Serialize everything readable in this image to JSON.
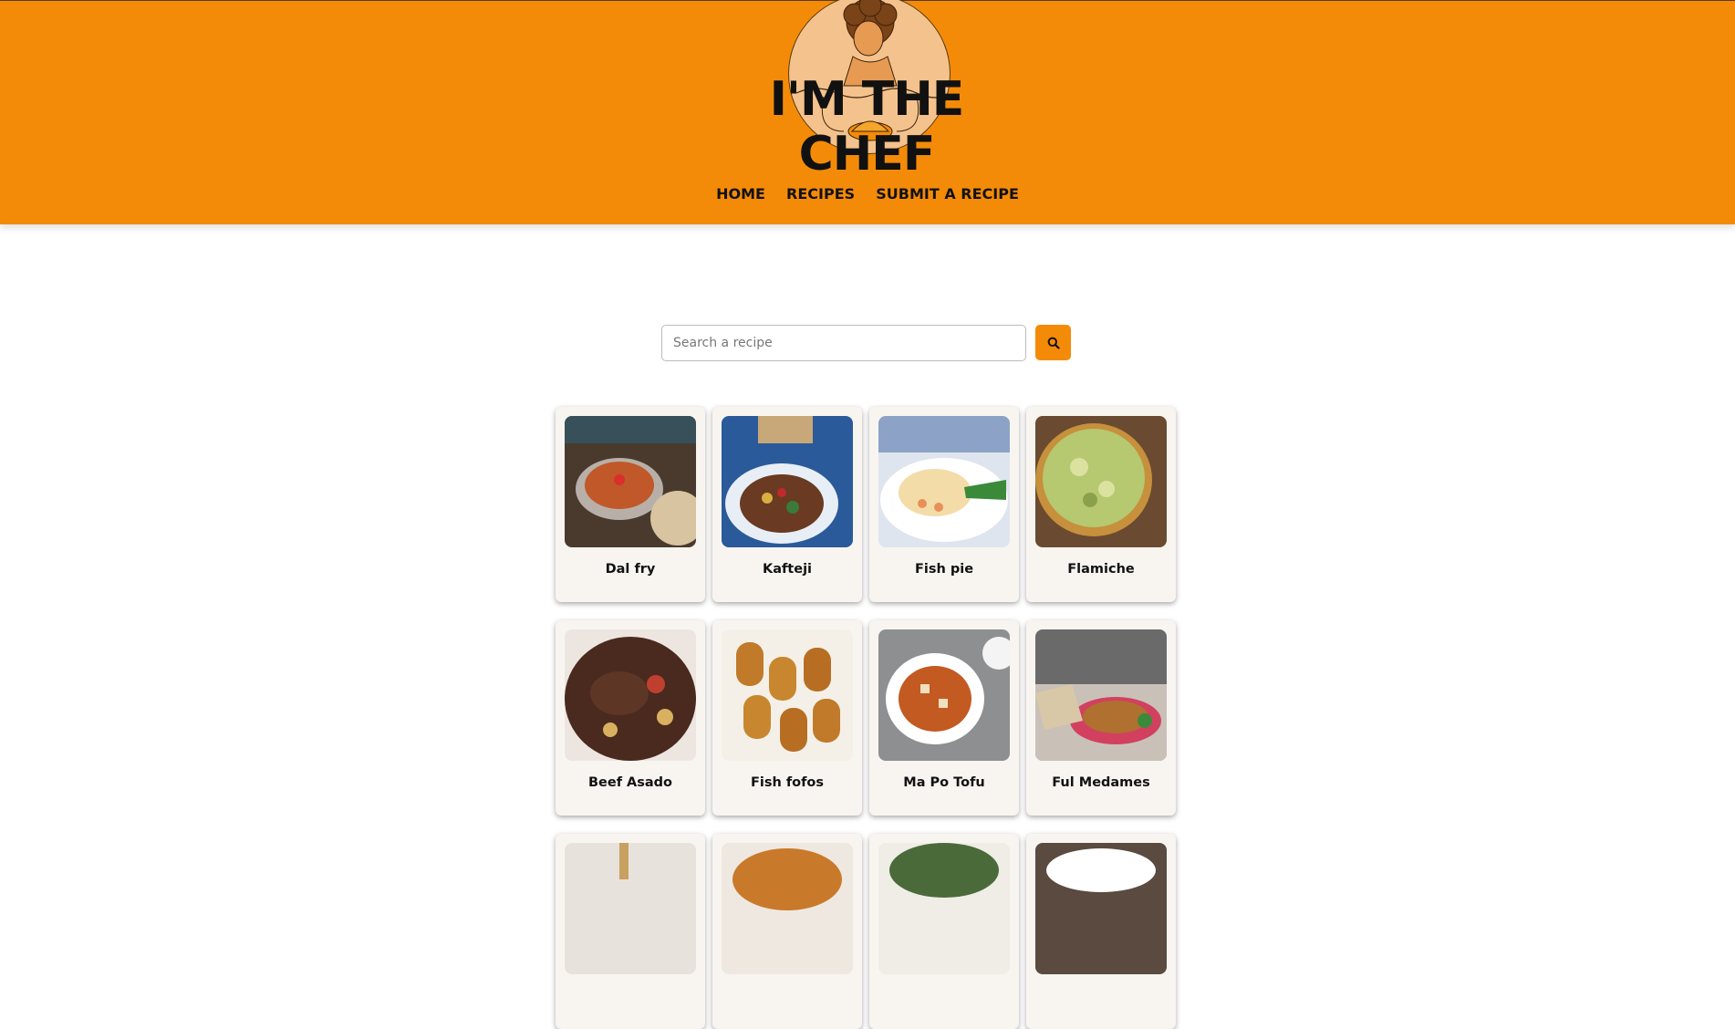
{
  "header": {
    "brand": "I'M THE CHEF",
    "accent_color": "#f48b08",
    "logo_icon": "chef-avatar-icon"
  },
  "nav": {
    "items": [
      {
        "label": "HOME"
      },
      {
        "label": "RECIPES"
      },
      {
        "label": "SUBMIT A RECIPE"
      }
    ]
  },
  "search": {
    "placeholder": "Search a recipe",
    "value": "",
    "button_icon": "search-icon"
  },
  "recipes": [
    {
      "name": "Dal fry"
    },
    {
      "name": "Kafteji"
    },
    {
      "name": "Fish pie"
    },
    {
      "name": "Flamiche"
    },
    {
      "name": "Beef Asado"
    },
    {
      "name": "Fish fofos"
    },
    {
      "name": "Ma Po Tofu"
    },
    {
      "name": "Ful Medames"
    }
  ]
}
